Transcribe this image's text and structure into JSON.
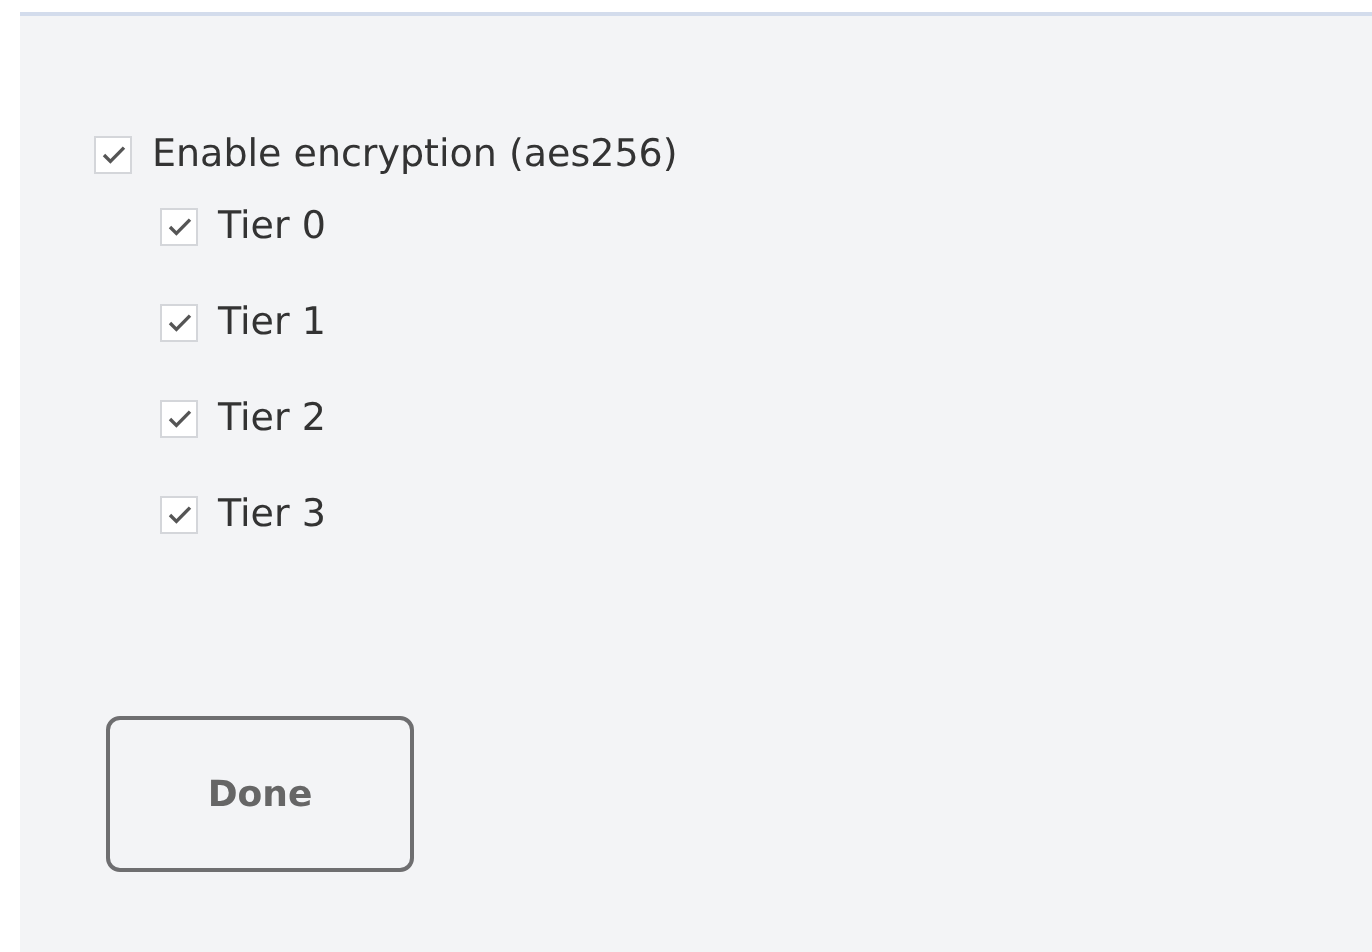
{
  "encryption": {
    "label": "Enable encryption (aes256)",
    "checked": true,
    "tiers": [
      {
        "label": "Tier 0",
        "checked": true
      },
      {
        "label": "Tier 1",
        "checked": true
      },
      {
        "label": "Tier 2",
        "checked": true
      },
      {
        "label": "Tier 3",
        "checked": true
      }
    ]
  },
  "buttons": [
    {
      "label": "Done"
    }
  ]
}
